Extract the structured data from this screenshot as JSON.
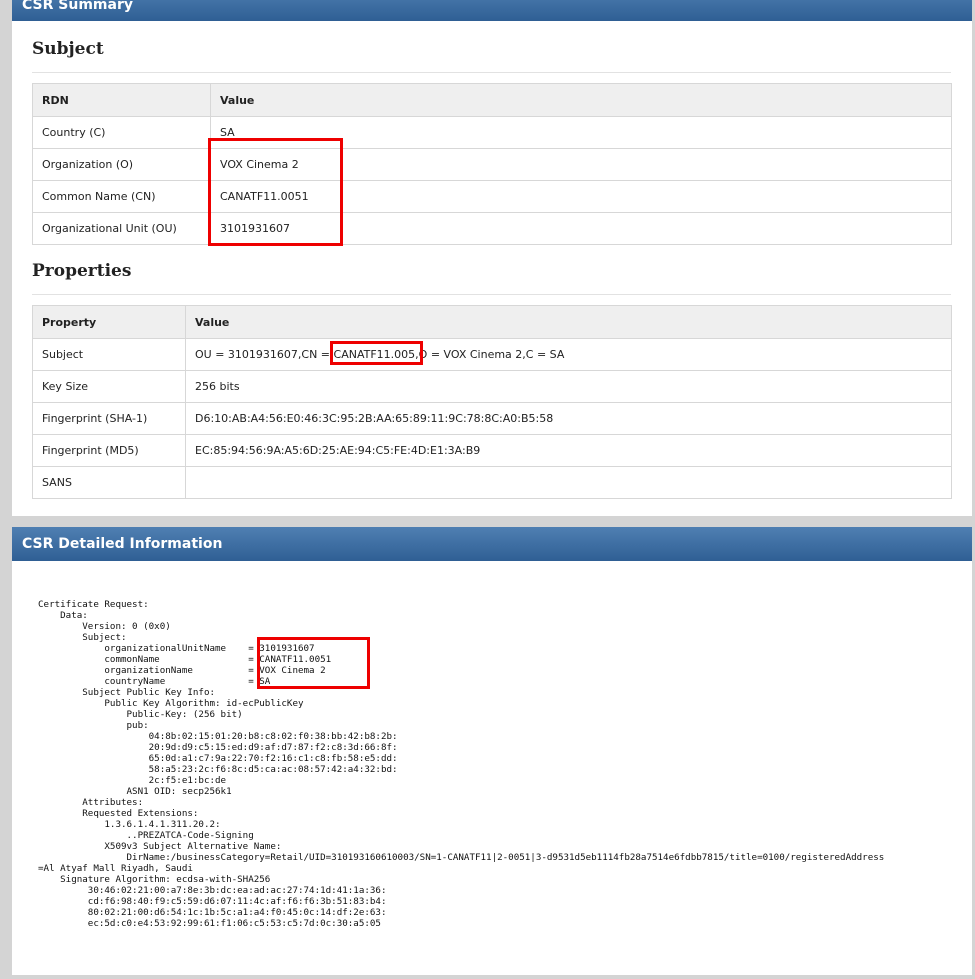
{
  "summary": {
    "header": "CSR Summary",
    "subject_title": "Subject",
    "subject_table": {
      "col_rdn": "RDN",
      "col_value": "Value",
      "rows": [
        {
          "rdn": "Country (C)",
          "value": "SA"
        },
        {
          "rdn": "Organization (O)",
          "value": "VOX Cinema 2"
        },
        {
          "rdn": "Common Name (CN)",
          "value": "CANATF11.0051"
        },
        {
          "rdn": "Organizational Unit (OU)",
          "value": "3101931607"
        }
      ]
    },
    "properties_title": "Properties",
    "properties_table": {
      "col_property": "Property",
      "col_value": "Value",
      "subject_row": {
        "label": "Subject",
        "prefix": "OU = 3101931607,CN = ",
        "cn": "CANATF11.005",
        "suffix": ",O = VOX Cinema 2,C = SA"
      },
      "rows": [
        {
          "property": "Key Size",
          "value": "256 bits"
        },
        {
          "property": "Fingerprint (SHA-1)",
          "value": "D6:10:AB:A4:56:E0:46:3C:95:2B:AA:65:89:11:9C:78:8C:A0:B5:58"
        },
        {
          "property": "Fingerprint (MD5)",
          "value": "EC:85:94:56:9A:A5:6D:25:AE:94:C5:FE:4D:E1:3A:B9"
        },
        {
          "property": "SANS",
          "value": ""
        }
      ]
    }
  },
  "detail": {
    "header": "CSR Detailed Information",
    "text": "Certificate Request:\n    Data:\n        Version: 0 (0x0)\n        Subject:\n            organizationalUnitName    = 3101931607\n            commonName                = CANATF11.0051\n            organizationName          = VOX Cinema 2\n            countryName               = SA\n        Subject Public Key Info:\n            Public Key Algorithm: id-ecPublicKey\n                Public-Key: (256 bit)\n                pub:\n                    04:8b:02:15:01:20:b8:c8:02:f0:38:bb:42:b8:2b:\n                    20:9d:d9:c5:15:ed:d9:af:d7:87:f2:c8:3d:66:8f:\n                    65:0d:a1:c7:9a:22:70:f2:16:c1:c8:fb:58:e5:dd:\n                    58:a5:23:2c:f6:8c:d5:ca:ac:08:57:42:a4:32:bd:\n                    2c:f5:e1:bc:de\n                ASN1 OID: secp256k1\n        Attributes:\n        Requested Extensions:\n            1.3.6.1.4.1.311.20.2:\n                ..PREZATCA-Code-Signing\n            X509v3 Subject Alternative Name:\n                DirName:/businessCategory=Retail/UID=310193160610003/SN=1-CANATF11|2-0051|3-d9531d5eb1114fb28a7514e6fdbb7815/title=0100/registeredAddress\n=Al Atyaf Mall Riyadh, Saudi\n    Signature Algorithm: ecdsa-with-SHA256\n         30:46:02:21:00:a7:8e:3b:dc:ea:ad:ac:27:74:1d:41:1a:36:\n         cd:f6:98:40:f9:c5:59:d6:07:11:4c:af:f6:f6:3b:51:83:b4:\n         80:02:21:00:d6:54:1c:1b:5c:a1:a4:f0:45:0c:14:df:2e:63:\n         ec:5d:c0:e4:53:92:99:61:f1:06:c5:53:c5:7d:0c:30:a5:05"
  }
}
